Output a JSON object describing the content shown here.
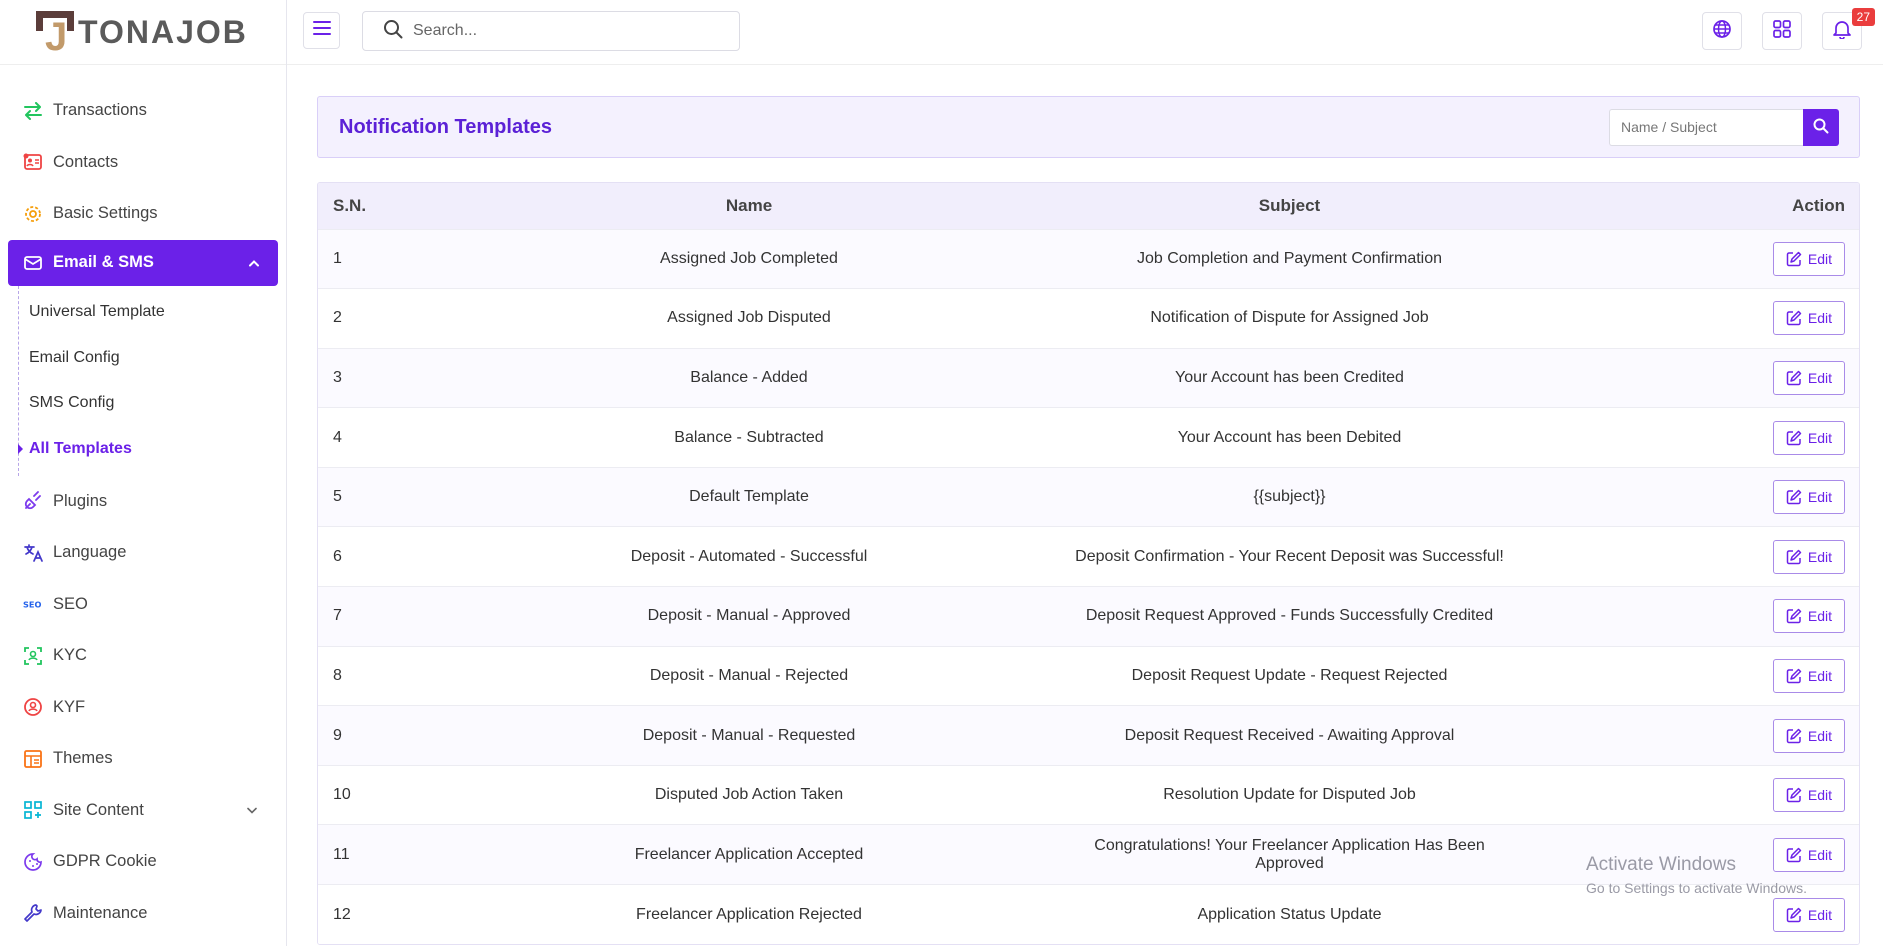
{
  "brand": {
    "name": "TONAJOB",
    "mark": "J"
  },
  "colors": {
    "accent": "#6b21e8",
    "header_bg": "#f4f1fe",
    "badge": "#ea3d3d"
  },
  "sidebar": {
    "items_top": [
      {
        "label": "Transactions",
        "icon": "transfer-icon",
        "color": "#22c55e"
      },
      {
        "label": "Contacts",
        "icon": "contact-card-icon",
        "color": "#ef4444"
      },
      {
        "label": "Basic Settings",
        "icon": "gear-icon",
        "color": "#f59e0b"
      }
    ],
    "active_group": {
      "label": "Email & SMS",
      "icon": "envelope-icon"
    },
    "subitems": [
      {
        "label": "Universal Template"
      },
      {
        "label": "Email Config"
      },
      {
        "label": "SMS Config"
      },
      {
        "label": "All Templates",
        "active": true
      }
    ],
    "items_bottom": [
      {
        "label": "Plugins",
        "icon": "plug-icon",
        "color": "#7c3aed"
      },
      {
        "label": "Language",
        "icon": "translate-icon",
        "color": "#4338ca"
      },
      {
        "label": "SEO",
        "icon": "seo-icon",
        "color": "#2563eb"
      },
      {
        "label": "KYC",
        "icon": "scan-user-icon",
        "color": "#22c55e"
      },
      {
        "label": "KYF",
        "icon": "shield-user-icon",
        "color": "#ef4444"
      },
      {
        "label": "Themes",
        "icon": "layout-icon",
        "color": "#f97316"
      },
      {
        "label": "Site Content",
        "icon": "grid-plus-icon",
        "color": "#06b6d4",
        "has_children": true
      },
      {
        "label": "GDPR Cookie",
        "icon": "cookie-icon",
        "color": "#7c3aed"
      },
      {
        "label": "Maintenance",
        "icon": "wrench-icon",
        "color": "#4338ca"
      }
    ]
  },
  "topbar": {
    "search_placeholder": "Search...",
    "notifications_count": "27"
  },
  "main": {
    "title": "Notification Templates",
    "filter_placeholder": "Name / Subject",
    "columns": {
      "sn": "S.N.",
      "name": "Name",
      "subject": "Subject",
      "action": "Action"
    },
    "edit_label": "Edit",
    "rows": [
      {
        "sn": "1",
        "name": "Assigned Job Completed",
        "subject": "Job Completion and Payment Confirmation"
      },
      {
        "sn": "2",
        "name": "Assigned Job Disputed",
        "subject": "Notification of Dispute for Assigned Job"
      },
      {
        "sn": "3",
        "name": "Balance - Added",
        "subject": "Your Account has been Credited"
      },
      {
        "sn": "4",
        "name": "Balance - Subtracted",
        "subject": "Your Account has been Debited"
      },
      {
        "sn": "5",
        "name": "Default Template",
        "subject": "{{subject}}"
      },
      {
        "sn": "6",
        "name": "Deposit - Automated - Successful",
        "subject": "Deposit Confirmation - Your Recent Deposit was Successful!"
      },
      {
        "sn": "7",
        "name": "Deposit - Manual - Approved",
        "subject": "Deposit Request Approved - Funds Successfully Credited"
      },
      {
        "sn": "8",
        "name": "Deposit - Manual - Rejected",
        "subject": "Deposit Request Update - Request Rejected"
      },
      {
        "sn": "9",
        "name": "Deposit - Manual - Requested",
        "subject": "Deposit Request Received - Awaiting Approval"
      },
      {
        "sn": "10",
        "name": "Disputed Job Action Taken",
        "subject": "Resolution Update for Disputed Job"
      },
      {
        "sn": "11",
        "name": "Freelancer Application Accepted",
        "subject": "Congratulations! Your Freelancer Application Has Been Approved"
      },
      {
        "sn": "12",
        "name": "Freelancer Application Rejected",
        "subject": "Application Status Update"
      }
    ]
  },
  "watermark": {
    "line1": "Activate Windows",
    "line2": "Go to Settings to activate Windows."
  }
}
